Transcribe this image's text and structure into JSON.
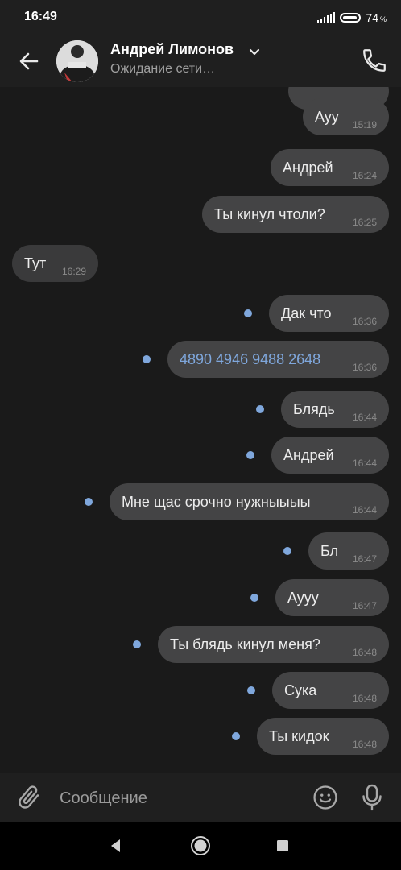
{
  "status_bar": {
    "time": "16:49",
    "battery": "74",
    "battery_suffix": "%"
  },
  "header": {
    "contact_name": "Андрей Лимонов",
    "contact_status": "Ожидание сети…",
    "icons": {
      "back": "arrow-left-icon",
      "chevron": "chevron-down-icon",
      "call": "phone-icon"
    }
  },
  "messages": [
    {
      "text": "Ауу",
      "time": "15:19",
      "direction": "out",
      "unread": false
    },
    {
      "text": "Андрей",
      "time": "16:24",
      "direction": "out",
      "unread": false
    },
    {
      "text": "Ты кинул чтоли?",
      "time": "16:25",
      "direction": "out",
      "unread": false
    },
    {
      "text": "Тут",
      "time": "16:29",
      "direction": "in",
      "unread": false
    },
    {
      "text": "Дак что",
      "time": "16:36",
      "direction": "out",
      "unread": true
    },
    {
      "text": "4890 4946 9488 2648",
      "time": "16:36",
      "direction": "out",
      "unread": true,
      "link": true
    },
    {
      "text": "Блядь",
      "time": "16:44",
      "direction": "out",
      "unread": true
    },
    {
      "text": "Андрей",
      "time": "16:44",
      "direction": "out",
      "unread": true
    },
    {
      "text": "Мне щас срочно нужныыыы",
      "time": "16:44",
      "direction": "out",
      "unread": true
    },
    {
      "text": "Бл",
      "time": "16:47",
      "direction": "out",
      "unread": true
    },
    {
      "text": "Аууу",
      "time": "16:47",
      "direction": "out",
      "unread": true
    },
    {
      "text": "Ты блядь кинул меня?",
      "time": "16:48",
      "direction": "out",
      "unread": true
    },
    {
      "text": "Сука",
      "time": "16:48",
      "direction": "out",
      "unread": true
    },
    {
      "text": "Ты кидок",
      "time": "16:48",
      "direction": "out",
      "unread": true
    }
  ],
  "composer": {
    "placeholder": "Сообщение",
    "icons": {
      "attach": "paperclip-icon",
      "emoji": "emoji-icon",
      "mic": "microphone-icon"
    }
  },
  "colors": {
    "background": "#1a1a1a",
    "bubble_out": "#444445",
    "bubble_in": "#3a3a3b",
    "accent": "#7fa7dc"
  }
}
